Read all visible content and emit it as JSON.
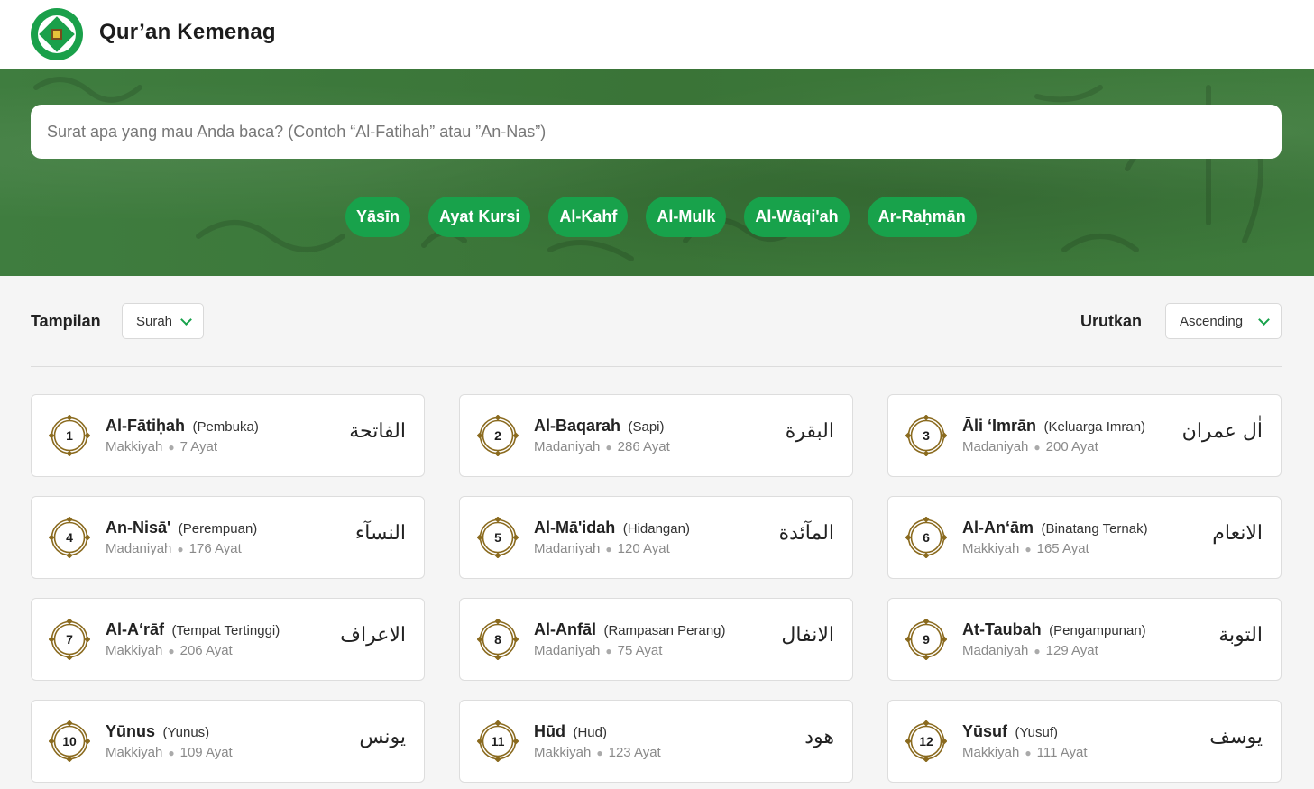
{
  "header": {
    "title": "Qur’an Kemenag"
  },
  "search": {
    "placeholder": "Surat apa yang mau Anda baca? (Contoh “Al-Fatihah” atau ”An-Nas”)"
  },
  "quick_links": [
    "Yāsīn",
    "Ayat Kursi",
    "Al-Kahf",
    "Al-Mulk",
    "Al-Wāqi'ah",
    "Ar-Raḥmān"
  ],
  "controls": {
    "view_label": "Tampilan",
    "view_value": "Surah",
    "sort_label": "Urutkan",
    "sort_value": "Ascending"
  },
  "colors": {
    "primary": "#18a24b",
    "badge_ring": "#8a6a1e",
    "hero_bg": "#3d7a3d"
  },
  "surahs": [
    {
      "number": "1",
      "latin": "Al-Fātiḥah",
      "meaning": "(Pembuka)",
      "place": "Makkiyah",
      "verses": "7 Ayat",
      "arabic": "الفاتحة"
    },
    {
      "number": "2",
      "latin": "Al-Baqarah",
      "meaning": "(Sapi)",
      "place": "Madaniyah",
      "verses": "286 Ayat",
      "arabic": "البقرة"
    },
    {
      "number": "3",
      "latin": "Āli ‘Imrān",
      "meaning": "(Keluarga Imran)",
      "place": "Madaniyah",
      "verses": "200 Ayat",
      "arabic": "اٰل عمران"
    },
    {
      "number": "4",
      "latin": "An-Nisā'",
      "meaning": "(Perempuan)",
      "place": "Madaniyah",
      "verses": "176 Ayat",
      "arabic": "النسآء"
    },
    {
      "number": "5",
      "latin": "Al-Mā'idah",
      "meaning": "(Hidangan)",
      "place": "Madaniyah",
      "verses": "120 Ayat",
      "arabic": "المآئدة"
    },
    {
      "number": "6",
      "latin": "Al-An‘ām",
      "meaning": "(Binatang Ternak)",
      "place": "Makkiyah",
      "verses": "165 Ayat",
      "arabic": "الانعام"
    },
    {
      "number": "7",
      "latin": "Al-A‘rāf",
      "meaning": "(Tempat Tertinggi)",
      "place": "Makkiyah",
      "verses": "206 Ayat",
      "arabic": "الاعراف"
    },
    {
      "number": "8",
      "latin": "Al-Anfāl",
      "meaning": "(Rampasan Perang)",
      "place": "Madaniyah",
      "verses": "75 Ayat",
      "arabic": "الانفال"
    },
    {
      "number": "9",
      "latin": "At-Taubah",
      "meaning": "(Pengampunan)",
      "place": "Madaniyah",
      "verses": "129 Ayat",
      "arabic": "التوبة"
    },
    {
      "number": "10",
      "latin": "Yūnus",
      "meaning": "(Yunus)",
      "place": "Makkiyah",
      "verses": "109 Ayat",
      "arabic": "يونس"
    },
    {
      "number": "11",
      "latin": "Hūd",
      "meaning": "(Hud)",
      "place": "Makkiyah",
      "verses": "123 Ayat",
      "arabic": "هود"
    },
    {
      "number": "12",
      "latin": "Yūsuf",
      "meaning": "(Yusuf)",
      "place": "Makkiyah",
      "verses": "111 Ayat",
      "arabic": "يوسف"
    }
  ]
}
